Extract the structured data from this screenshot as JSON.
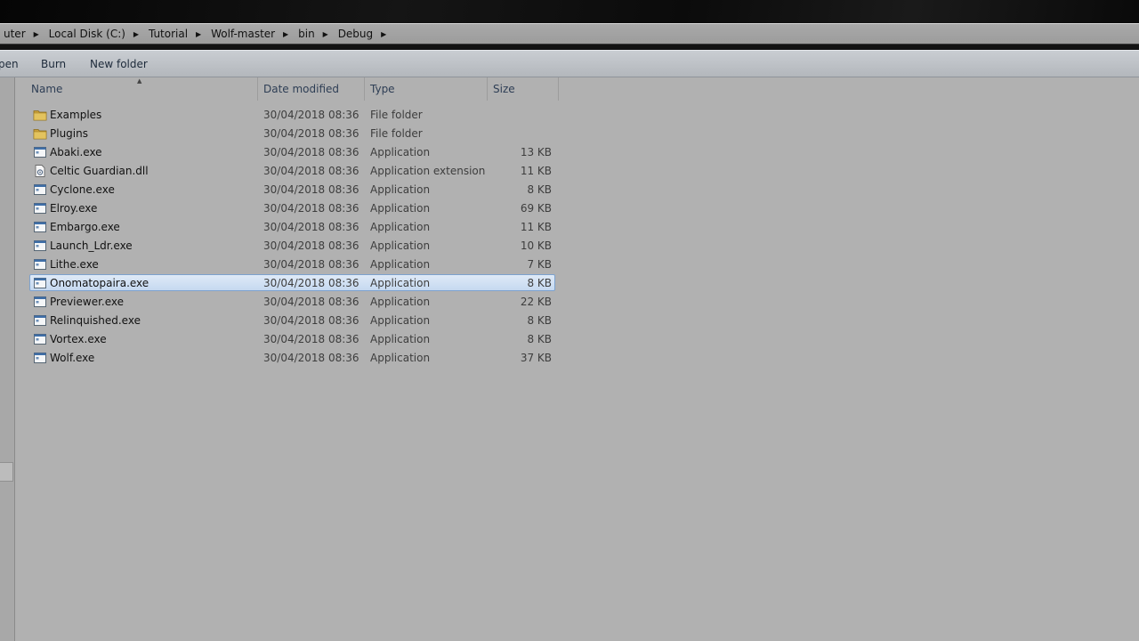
{
  "address_bar": {
    "breadcrumbs": [
      {
        "label": "uter"
      },
      {
        "label": "Local Disk (C:)"
      },
      {
        "label": "Tutorial"
      },
      {
        "label": "Wolf-master"
      },
      {
        "label": "bin"
      },
      {
        "label": "Debug"
      }
    ],
    "arrow_glyph": "▶"
  },
  "toolbar": {
    "open_label": "pen",
    "burn_label": "Burn",
    "new_folder_label": "New folder"
  },
  "columns": {
    "name": "Name",
    "date_modified": "Date modified",
    "type": "Type",
    "size": "Size",
    "sort_indicator": "▲"
  },
  "files": [
    {
      "name": "Examples",
      "date": "30/04/2018 08:36",
      "type": "File folder",
      "size": "",
      "icon": "folder-icon",
      "selected": false
    },
    {
      "name": "Plugins",
      "date": "30/04/2018 08:36",
      "type": "File folder",
      "size": "",
      "icon": "folder-icon",
      "selected": false
    },
    {
      "name": "Abaki.exe",
      "date": "30/04/2018 08:36",
      "type": "Application",
      "size": "13 KB",
      "icon": "application-icon",
      "selected": false
    },
    {
      "name": "Celtic Guardian.dll",
      "date": "30/04/2018 08:36",
      "type": "Application extension",
      "size": "11 KB",
      "icon": "dll-icon",
      "selected": false
    },
    {
      "name": "Cyclone.exe",
      "date": "30/04/2018 08:36",
      "type": "Application",
      "size": "8 KB",
      "icon": "application-icon",
      "selected": false
    },
    {
      "name": "Elroy.exe",
      "date": "30/04/2018 08:36",
      "type": "Application",
      "size": "69 KB",
      "icon": "application-icon",
      "selected": false
    },
    {
      "name": "Embargo.exe",
      "date": "30/04/2018 08:36",
      "type": "Application",
      "size": "11 KB",
      "icon": "application-icon",
      "selected": false
    },
    {
      "name": "Launch_Ldr.exe",
      "date": "30/04/2018 08:36",
      "type": "Application",
      "size": "10 KB",
      "icon": "application-icon",
      "selected": false
    },
    {
      "name": "Lithe.exe",
      "date": "30/04/2018 08:36",
      "type": "Application",
      "size": "7 KB",
      "icon": "application-icon",
      "selected": false
    },
    {
      "name": "Onomatopaira.exe",
      "date": "30/04/2018 08:36",
      "type": "Application",
      "size": "8 KB",
      "icon": "application-icon",
      "selected": true
    },
    {
      "name": "Previewer.exe",
      "date": "30/04/2018 08:36",
      "type": "Application",
      "size": "22 KB",
      "icon": "application-icon",
      "selected": false
    },
    {
      "name": "Relinquished.exe",
      "date": "30/04/2018 08:36",
      "type": "Application",
      "size": "8 KB",
      "icon": "application-icon",
      "selected": false
    },
    {
      "name": "Vortex.exe",
      "date": "30/04/2018 08:36",
      "type": "Application",
      "size": "8 KB",
      "icon": "application-icon",
      "selected": false
    },
    {
      "name": "Wolf.exe",
      "date": "30/04/2018 08:36",
      "type": "Application",
      "size": "37 KB",
      "icon": "application-icon",
      "selected": false
    }
  ],
  "colors": {
    "background": "#b1b1b1",
    "selection": "#c5d9f0",
    "selection_border": "#7da2ce",
    "header_text": "#2e3e55"
  }
}
